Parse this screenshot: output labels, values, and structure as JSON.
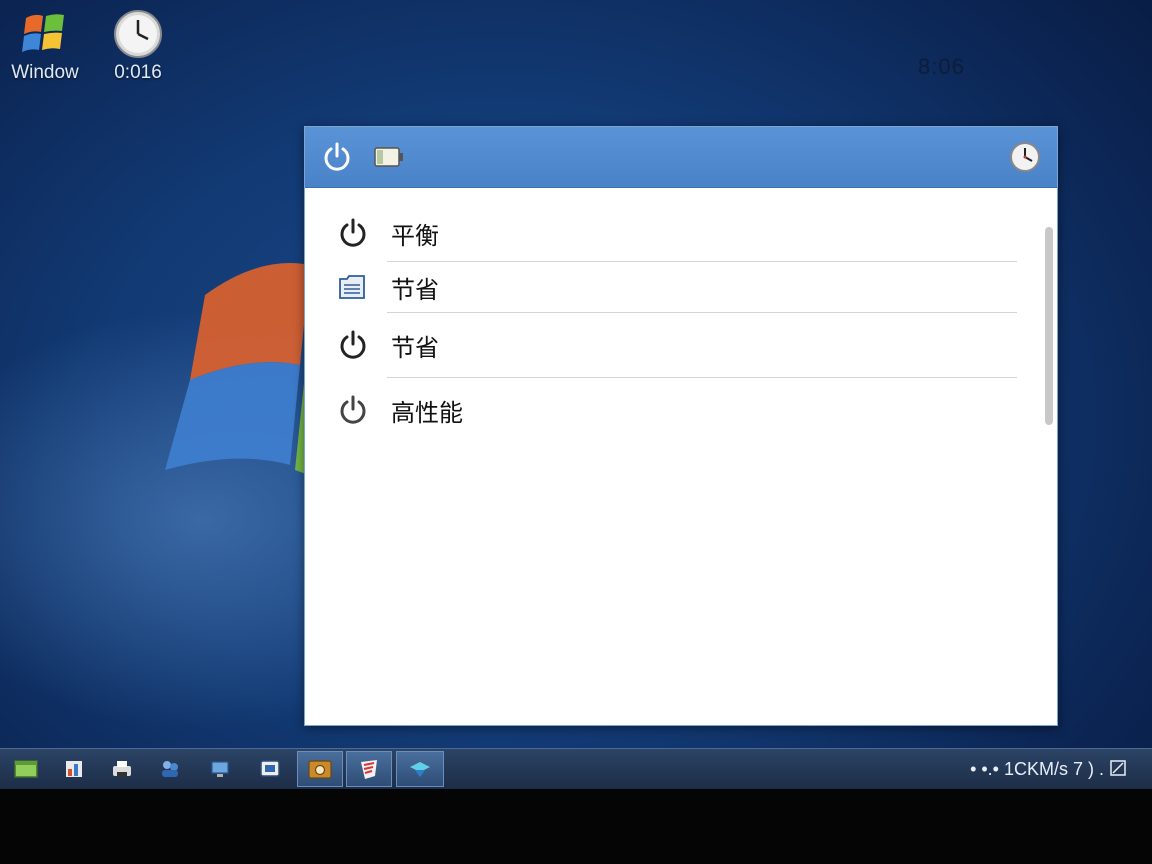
{
  "desktop": {
    "icons": [
      {
        "name": "windows-logo-icon",
        "label": "Window"
      },
      {
        "name": "clock-icon",
        "label": "0:016"
      }
    ],
    "top_clock": "8:06"
  },
  "panel": {
    "header": {
      "buttons": [
        {
          "icon": "power-icon"
        },
        {
          "icon": "battery-icon"
        },
        {
          "icon": "clock-icon"
        }
      ]
    },
    "plans": [
      {
        "label": "平衡",
        "icon": "power-icon"
      },
      {
        "label": "节省",
        "icon": "document-icon"
      },
      {
        "label": "节省",
        "icon": "power-icon"
      },
      {
        "label": "高性能",
        "icon": "power-icon"
      }
    ]
  },
  "taskbar": {
    "buttons": [
      "desktop-icon",
      "chart-icon",
      "printer-icon",
      "users-icon",
      "network-icon",
      "monitor-icon",
      "camera-icon",
      "shield-icon",
      "globe-icon"
    ],
    "tray_text": "• •.• 1CKM/s 7 ) . "
  },
  "colors": {
    "header_blue": "#4a82c8",
    "desktop_blue": "#123a74",
    "taskbar": "#1c2d47"
  }
}
